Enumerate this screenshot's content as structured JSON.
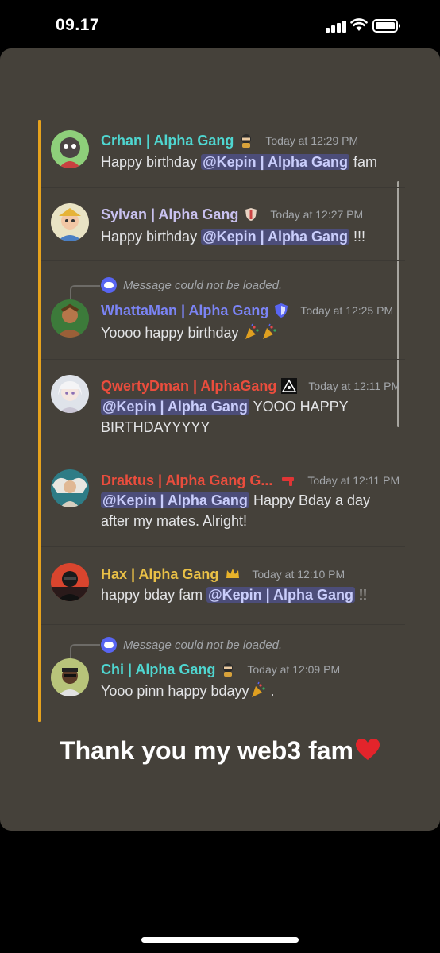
{
  "status_bar": {
    "time": "09.17"
  },
  "reply_reference_text": "Message could not be loaded.",
  "messages": [
    {
      "username": "Crhan | Alpha Gang",
      "name_color": "#4fd6d0",
      "role_icon": "ninja-emoji",
      "timestamp": "Today at 12:29 PM",
      "text_before": "Happy birthday ",
      "mention": "@Kepin | Alpha Gang",
      "text_after": " fam"
    },
    {
      "username": "Sylvan | Alpha Gang",
      "name_color": "#c9c1ef",
      "role_icon": "shield-badge-emoji",
      "timestamp": "Today at 12:27 PM",
      "text_before": "Happy birthday ",
      "mention": "@Kepin | Alpha Gang",
      "text_after": " !!!"
    },
    {
      "username": "WhattaMan | Alpha Gang",
      "name_color": "#7b84f5",
      "role_icon": "blue-shield-icon",
      "timestamp": "Today at 12:25 PM",
      "text": "Yoooo happy birthday",
      "emoji": "party-popper-emoji"
    },
    {
      "username": "QwertyDman | AlphaGang",
      "name_color": "#ea4d3d",
      "role_icon": "eye-triangle-icon",
      "timestamp": "Today at 12:11 PM",
      "mention": "@Kepin | Alpha Gang",
      "text_line1_after": " YOOO HAPPY",
      "text_line2": "BIRTHDAYYYYY"
    },
    {
      "username": "Draktus | Alpha Gang G...",
      "name_color": "#ea4d3d",
      "role_icon": "pistol-emoji",
      "timestamp": "Today at 12:11 PM",
      "mention": "@Kepin | Alpha Gang",
      "text_line1_after": " Happy Bday a day",
      "text_line2": "after my mates. Alright!"
    },
    {
      "username": "Hax | Alpha Gang",
      "name_color": "#e9c046",
      "role_icon": "crown-emoji",
      "timestamp": "Today at 12:10 PM",
      "text_before": "happy bday fam ",
      "mention": "@Kepin | Alpha Gang",
      "text_after": " !!"
    },
    {
      "username": "Chi | Alpha Gang",
      "name_color": "#4fd6d0",
      "role_icon": "ninja-emoji",
      "timestamp": "Today at 12:09 PM",
      "text": "Yooo pinn happy bdayy",
      "emoji": "party-popper-emoji",
      "text_after": " ."
    }
  ],
  "caption": {
    "text": "Thank you my web3 fam",
    "emoji": "red-heart-emoji"
  },
  "colors": {
    "card_bg": "#45413a",
    "thread_bar": "#e6a21d",
    "mention_bg": "#5865f2"
  }
}
